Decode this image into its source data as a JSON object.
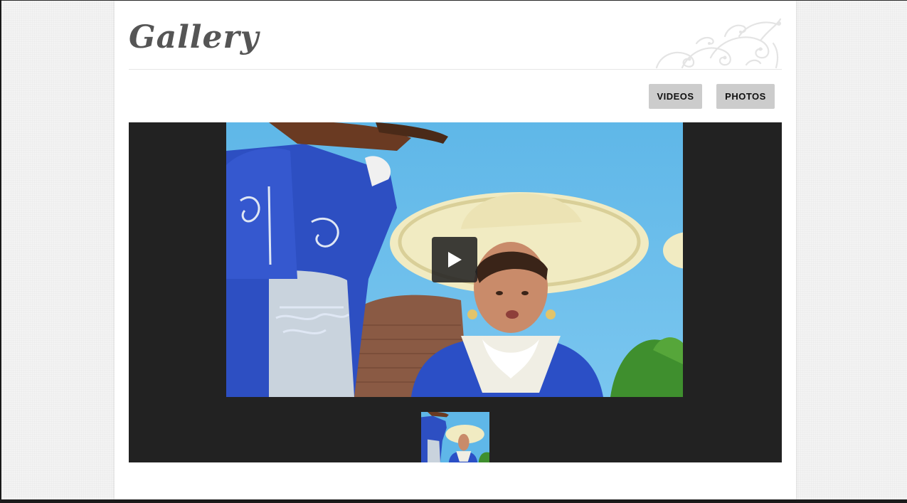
{
  "page": {
    "title": "Gallery"
  },
  "tabs": {
    "videos_label": "VIDEOS",
    "photos_label": "PHOTOS"
  },
  "gallery": {
    "selected_thumbnail": 1,
    "thumbnail_count": 1
  },
  "icons": {
    "play": "play-icon",
    "ornament": "flourish-ornament"
  },
  "colors": {
    "title": "#555555",
    "stage_background": "#222222",
    "button_background": "#cccccc",
    "button_text": "#111111"
  }
}
